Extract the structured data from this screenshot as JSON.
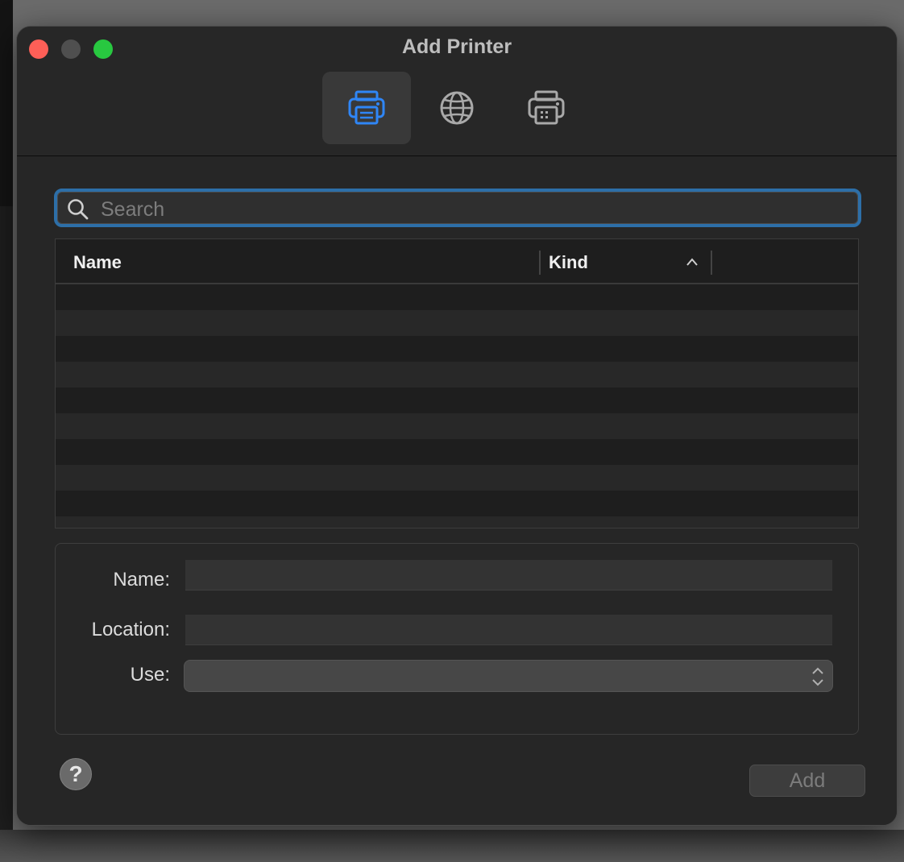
{
  "window": {
    "title": "Add Printer"
  },
  "toolbar": {
    "tabs": [
      {
        "icon": "printer-icon",
        "active": true
      },
      {
        "icon": "globe-icon",
        "active": false
      },
      {
        "icon": "windows-printer-icon",
        "active": false
      }
    ]
  },
  "search": {
    "placeholder": "Search",
    "value": ""
  },
  "table": {
    "columns": [
      "Name",
      "Kind"
    ],
    "sort_column": "Kind",
    "sort_direction": "ascending",
    "rows": []
  },
  "form": {
    "name_label": "Name:",
    "name_value": "",
    "location_label": "Location:",
    "location_value": "",
    "use_label": "Use:",
    "use_value": ""
  },
  "footer": {
    "help_label": "?",
    "add_label": "Add",
    "add_enabled": false
  },
  "colors": {
    "accent": "#2d6fa8",
    "active_icon": "#2f86f6",
    "close": "#fe5f57",
    "maximize": "#28c840"
  }
}
